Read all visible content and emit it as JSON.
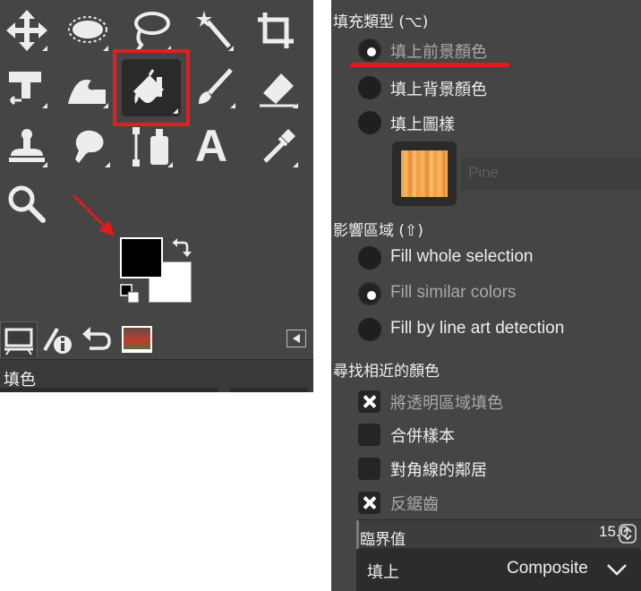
{
  "toolbox": {
    "tools": [
      {
        "name": "move-tool"
      },
      {
        "name": "ellipse-select-tool"
      },
      {
        "name": "free-select-tool"
      },
      {
        "name": "fuzzy-select-tool"
      },
      {
        "name": "crop-tool"
      },
      {
        "name": "unified-transform-tool"
      },
      {
        "name": "warp-transform-tool"
      },
      {
        "name": "bucket-fill-tool",
        "selected": true
      },
      {
        "name": "paintbrush-tool"
      },
      {
        "name": "eraser-tool"
      },
      {
        "name": "clone-tool"
      },
      {
        "name": "smudge-tool"
      },
      {
        "name": "paths-tool"
      },
      {
        "name": "text-tool"
      },
      {
        "name": "color-picker-tool"
      },
      {
        "name": "zoom-tool"
      }
    ],
    "text_tool_glyph": "A",
    "foreground_color": "#000000",
    "background_color": "#ffffff",
    "highlight_color": "#e02020",
    "annotation_arrow_color": "#e01b1b"
  },
  "dock_tabs": [
    {
      "icon": "tool-options-icon",
      "active": true
    },
    {
      "icon": "device-status-icon",
      "active": false
    },
    {
      "icon": "undo-history-icon",
      "active": false
    },
    {
      "icon": "image-thumbnail-icon",
      "active": false
    }
  ],
  "left_panel": {
    "title": "填色"
  },
  "fill_type": {
    "heading": "填充類型 (⌥)",
    "options": [
      {
        "label": "填上前景顏色",
        "checked": true
      },
      {
        "label": "填上背景顏色",
        "checked": false
      },
      {
        "label": "填上圖樣",
        "checked": false
      }
    ],
    "pattern_name": "Pine"
  },
  "affected_area": {
    "heading": "影響區域 (⇧)",
    "options": [
      {
        "label": "Fill whole selection",
        "checked": false
      },
      {
        "label": "Fill similar colors",
        "checked": true
      },
      {
        "label": "Fill by line art detection",
        "checked": false
      }
    ]
  },
  "finding_similar": {
    "heading": "尋找相近的顏色",
    "checkboxes": [
      {
        "label": "將透明區域填色",
        "checked": true
      },
      {
        "label": "合併樣本",
        "checked": false
      },
      {
        "label": "對角線的鄰居",
        "checked": false
      },
      {
        "label": "反鋸齒",
        "checked": true
      }
    ],
    "threshold": {
      "label": "臨界值",
      "value": "15.0"
    },
    "fill_by": {
      "label": "填上",
      "value": "Composite"
    }
  },
  "annotation": {
    "underline_color": "#e01b1b"
  }
}
